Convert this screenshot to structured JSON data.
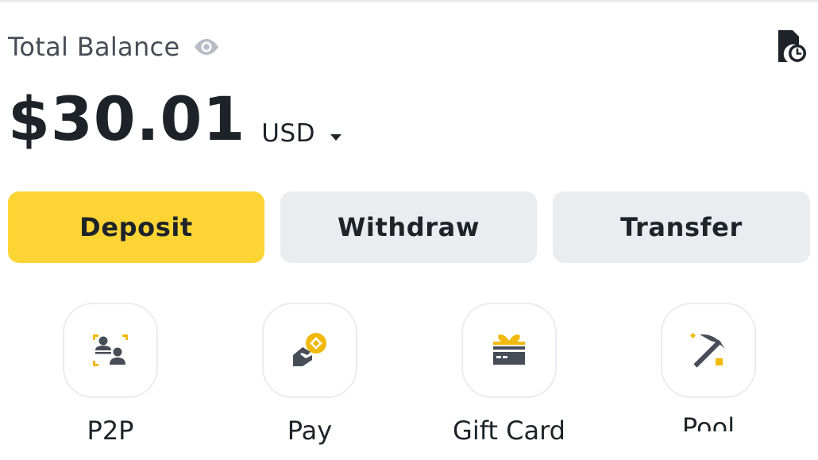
{
  "balance": {
    "label": "Total Balance",
    "amount": "$30.01",
    "currency": "USD"
  },
  "actions": {
    "deposit": "Deposit",
    "withdraw": "Withdraw",
    "transfer": "Transfer"
  },
  "shortcuts": [
    {
      "label": "P2P",
      "icon": "p2p-icon"
    },
    {
      "label": "Pay",
      "icon": "pay-icon"
    },
    {
      "label": "Gift Card",
      "icon": "gift-card-icon"
    },
    {
      "label": "Pool",
      "icon": "pickaxe-icon"
    }
  ],
  "colors": {
    "accent": "#fcd535",
    "text": "#1e2329",
    "muted": "#474d57",
    "button_bg": "#eaecef",
    "icon_gold": "#f0b90b"
  }
}
